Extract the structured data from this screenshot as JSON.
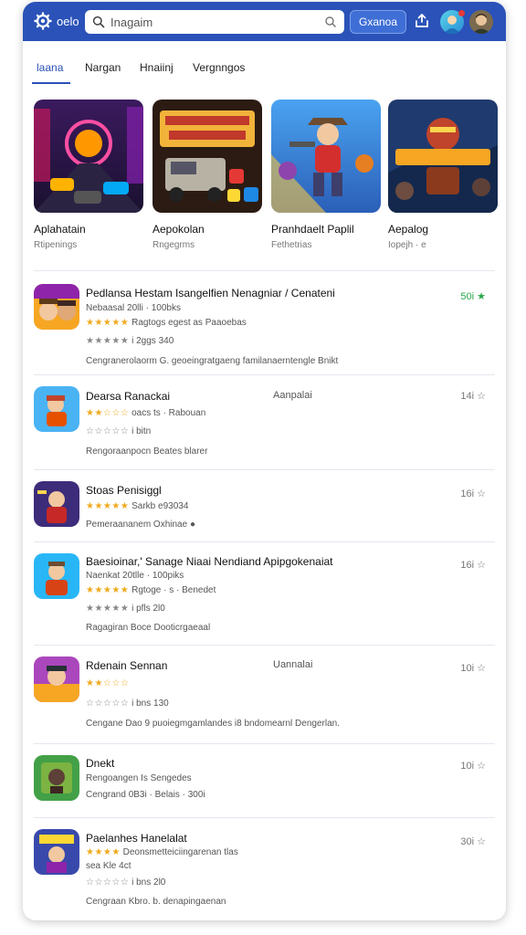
{
  "header": {
    "logo_text": "oelo",
    "search_placeholder": "Inagaim",
    "search_button": "Gxanoa"
  },
  "tabs": [
    {
      "label": "laana",
      "active": true
    },
    {
      "label": "Nargan",
      "active": false
    },
    {
      "label": "Hnaiinj",
      "active": false
    },
    {
      "label": "Vergnngos",
      "active": false
    }
  ],
  "featured": [
    {
      "title": "Aplahatain",
      "subtitle": "Rtipenings",
      "art": "neon-city-racing"
    },
    {
      "title": "Aepokolan",
      "subtitle": "Rngegrms",
      "art": "truck-adventure"
    },
    {
      "title": "Pranhdaelt Paplil",
      "subtitle": "Fethetrias",
      "art": "cowboy-hero"
    },
    {
      "title": "Aepalog",
      "subtitle": "Iopejh · e",
      "art": "robot-fighter"
    }
  ],
  "apps": [
    {
      "title": "Pedlansa Hestam Isangelfien Nenagniar / Cenateni",
      "category": "",
      "line1": "Nebaasal 20lli · 100bks",
      "stars1": "★★★★★",
      "line1b": "Ragtogs egest as Paaoebas",
      "stars2": "★★★★★",
      "line2": "i 2ggs 340",
      "desc": "Cengranerolaorm G. geoeingratgaeng familanaerntengle Bnikt",
      "rating": "50i ★",
      "rating_green": true
    },
    {
      "title": "Dearsa Ranackai",
      "category": "Aanpalai",
      "line1": "",
      "stars1": "★★☆☆☆",
      "line1b": "oacs ts · Rabouan",
      "stars2": "☆☆☆☆☆",
      "line2": "i bitn",
      "desc": "Rengoraanpocn Beates blarer",
      "rating": "14i ☆",
      "rating_green": false
    },
    {
      "title": "Stoas Penisiggl",
      "category": "",
      "line1": "",
      "stars1": "★★★★★",
      "line1b": "Sarkb e93034",
      "stars2": "",
      "line2": "",
      "desc": "Pemeraananem Oxhinae ●",
      "rating": "16i ☆",
      "rating_green": false
    },
    {
      "title": "Baesioinar,' Sanage Niaai Nendiand Apipgokenaiat",
      "category": "",
      "line1": "Naenkat 20tlle · 100piks",
      "stars1": "★★★★★",
      "line1b": "Rgtoge · s · Benedet",
      "stars2": "★★★★★",
      "line2": "i pfls 2l0",
      "desc": "Ragagiran Boce Dooticrgaeaal",
      "rating": "16i ☆",
      "rating_green": false
    },
    {
      "title": "Rdenain Sennan",
      "category": "Uannalai",
      "line1": "",
      "stars1": "★★☆☆☆",
      "line1b": "",
      "stars2": "☆☆☆☆☆",
      "line2": "i bns 130",
      "desc": "Cengane Dao 9 puoiegmgamlandes i8 bndomearnl Dengerlan.",
      "rating": "10i ☆",
      "rating_green": false
    },
    {
      "title": "Dnekt",
      "category": "",
      "line1": "Rengoangen Is Sengedes",
      "stars1": "",
      "line1b": "",
      "stars2": "",
      "line2": "Cengrand 0B3i · Belais · 300i",
      "desc": "",
      "rating": "10i ☆",
      "rating_green": false
    },
    {
      "title": "Paelanhes Hanelalat",
      "category": "",
      "line1": "Deonsmetteiciingarenan tlas",
      "stars1": "★★★★",
      "line1b": "",
      "stars2": "☆☆☆☆☆",
      "line2": "i bns 2l0",
      "desc": "Cengraan Kbro. b. denapingaenan",
      "rating": "30i ☆",
      "rating_green": false,
      "extra": "sea Kle 4ct"
    }
  ],
  "colors": {
    "header_bg": "#2a52b8",
    "accent": "#2a52b8",
    "star": "#f0a91d",
    "rating_green": "#2aa84a"
  }
}
